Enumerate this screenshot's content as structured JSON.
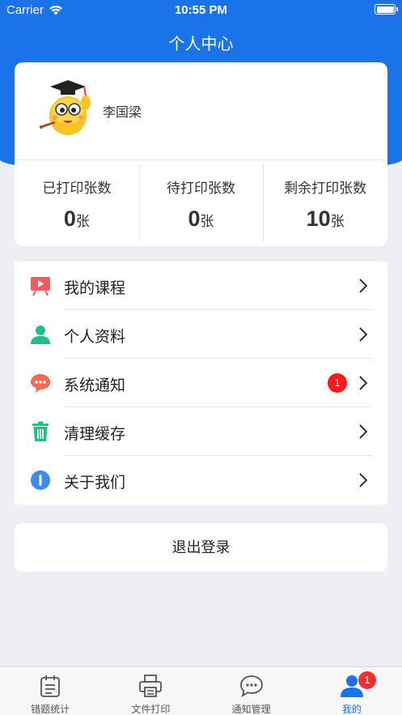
{
  "status_bar": {
    "carrier": "Carrier",
    "time": "10:55 PM"
  },
  "nav": {
    "title": "个人中心"
  },
  "profile": {
    "username": "李国梁"
  },
  "stats": [
    {
      "label": "已打印张数",
      "value": "0",
      "unit": "张"
    },
    {
      "label": "待打印张数",
      "value": "0",
      "unit": "张"
    },
    {
      "label": "剩余打印张数",
      "value": "10",
      "unit": "张"
    }
  ],
  "menu": [
    {
      "label": "我的课程",
      "icon": "course-icon"
    },
    {
      "label": "个人资料",
      "icon": "profile-icon"
    },
    {
      "label": "系统通知",
      "icon": "message-icon",
      "badge": "1"
    },
    {
      "label": "清理缓存",
      "icon": "trash-icon"
    },
    {
      "label": "关于我们",
      "icon": "info-icon"
    }
  ],
  "logout": {
    "label": "退出登录"
  },
  "tabs": [
    {
      "label": "错题统计",
      "icon": "calendar-icon"
    },
    {
      "label": "文件打印",
      "icon": "printer-icon"
    },
    {
      "label": "通知管理",
      "icon": "chat-icon"
    },
    {
      "label": "我的",
      "icon": "user-icon",
      "badge": "1",
      "active": true
    }
  ],
  "colors": {
    "primary": "#1a73e8",
    "badge": "#ff1a1a",
    "background": "#eeeff4"
  }
}
